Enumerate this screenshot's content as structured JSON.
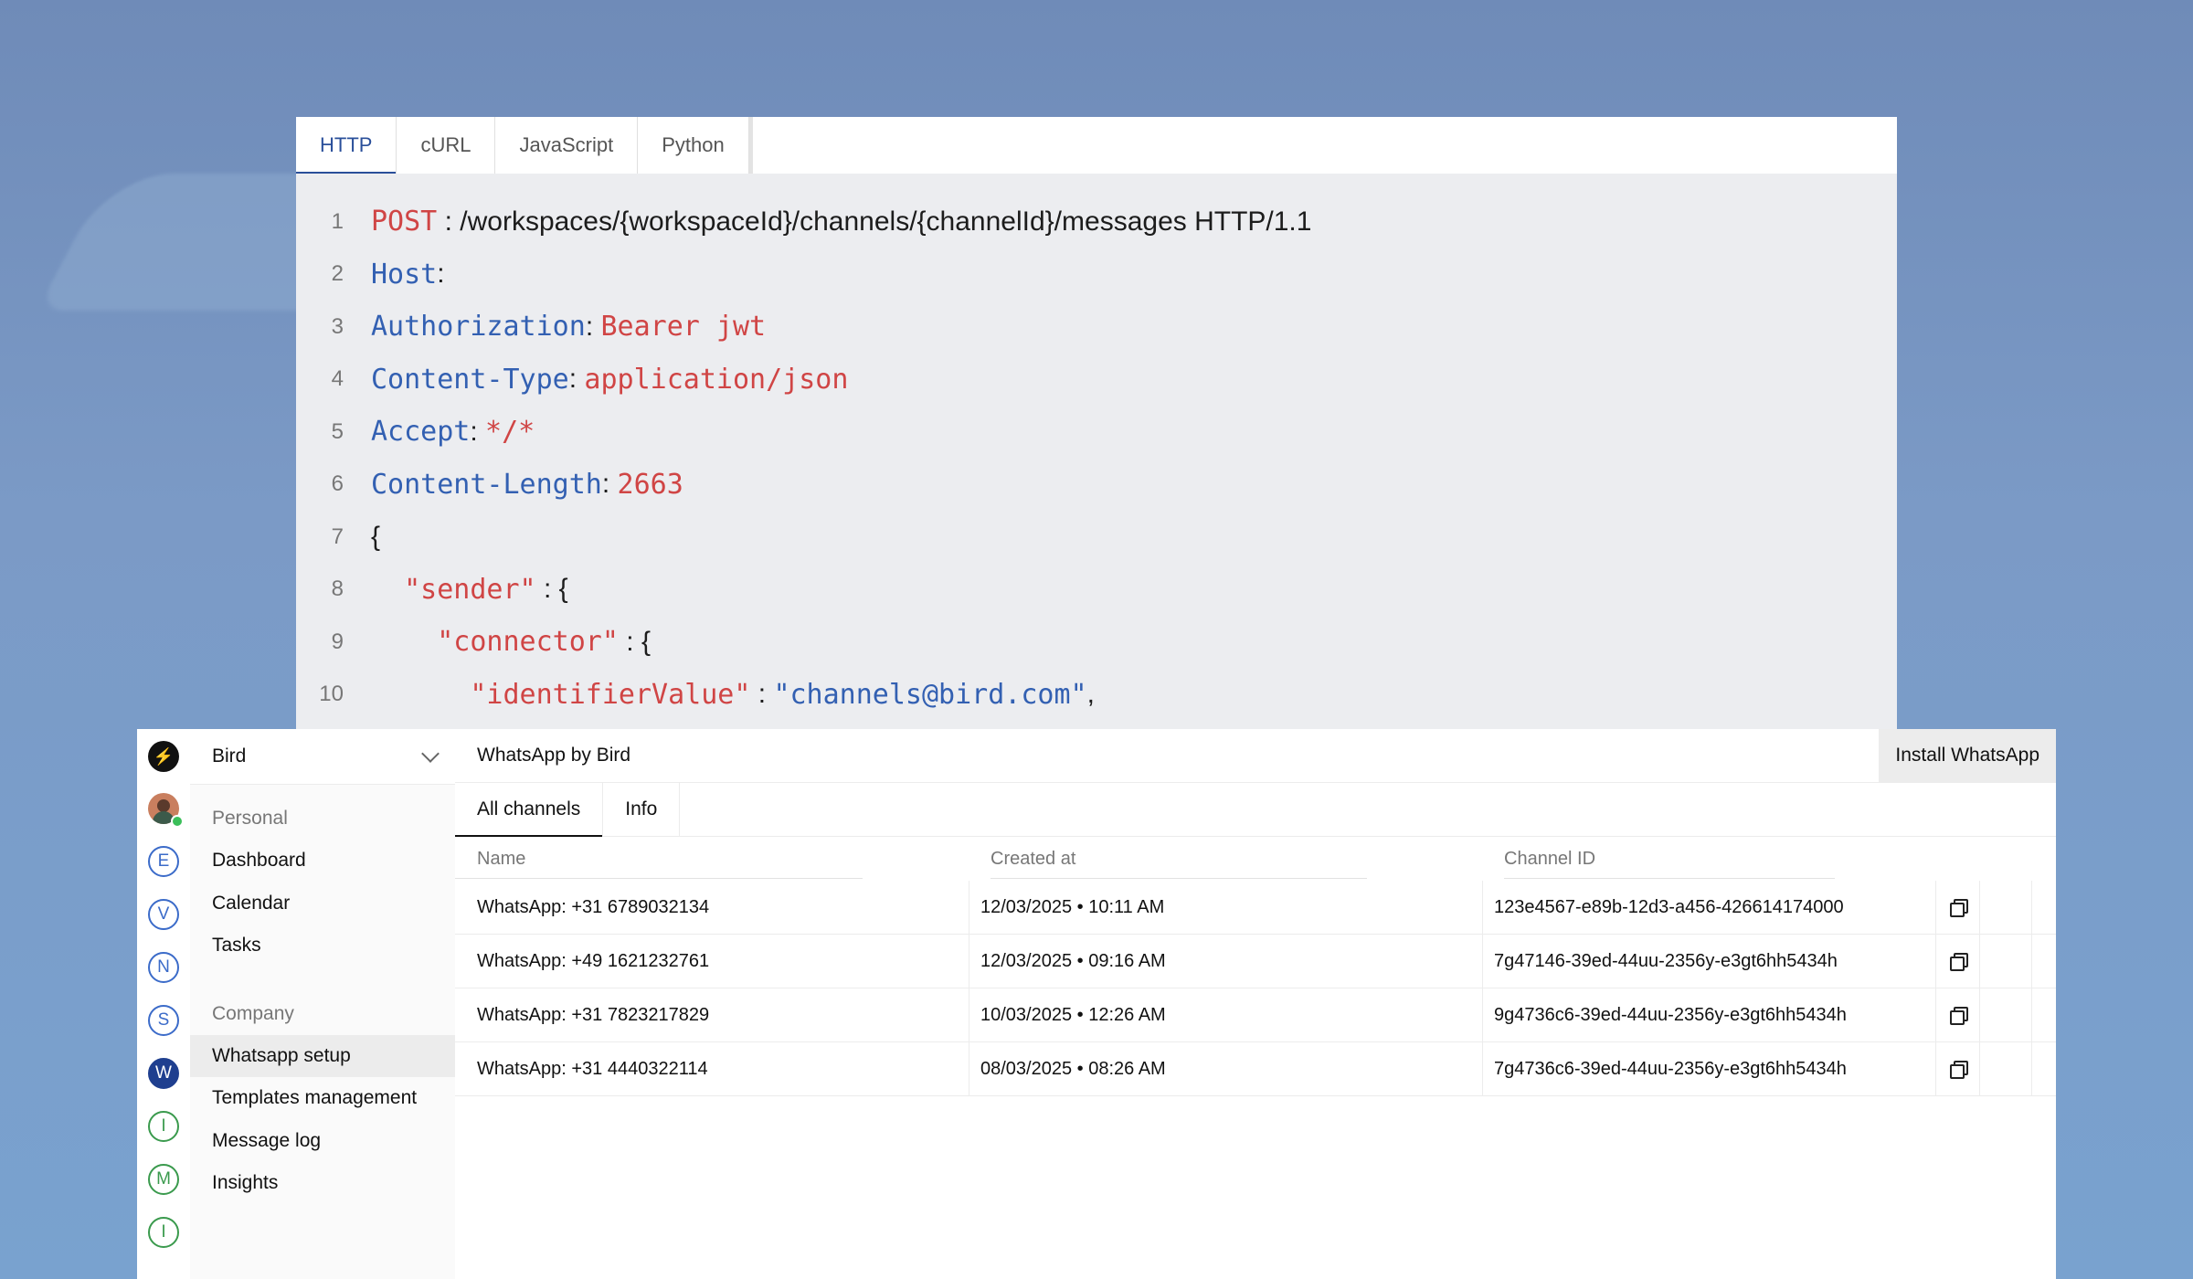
{
  "code_panel": {
    "tabs": [
      "HTTP",
      "cURL",
      "JavaScript",
      "Python"
    ],
    "active_tab": "HTTP",
    "lines": [
      {
        "num": "1",
        "method": "POST",
        "sep": " : ",
        "path": "/workspaces/{workspaceId}/channels/{channelId}/messages HTTP/1.1"
      },
      {
        "num": "2",
        "key": "Host",
        "colon": ":"
      },
      {
        "num": "3",
        "key": "Authorization",
        "colon": ": ",
        "value": "Bearer jwt"
      },
      {
        "num": "4",
        "key": "Content-Type",
        "colon": ": ",
        "value": "application/json"
      },
      {
        "num": "5",
        "key": "Accept",
        "colon": ": ",
        "value": "*/*"
      },
      {
        "num": "6",
        "key": "Content-Length",
        "colon": ": ",
        "value": "2663"
      },
      {
        "num": "7",
        "text": "{"
      },
      {
        "num": "8",
        "indent": "  ",
        "key": "\"sender\"",
        "colon": " : {"
      },
      {
        "num": "9",
        "indent": "    ",
        "key": "\"connector\"",
        "colon": " : {"
      },
      {
        "num": "10",
        "indent": "      ",
        "key": "\"identifierValue\"",
        "colon": " : ",
        "value": "\"channels@bird.com\"",
        "tail": ","
      }
    ]
  },
  "app": {
    "rail": {
      "logo": "⚡",
      "workspaces": [
        "E",
        "V",
        "N",
        "S",
        "W",
        "I",
        "M",
        "I"
      ]
    },
    "sidebar": {
      "org_name": "Bird",
      "personal_label": "Personal",
      "personal_items": [
        "Dashboard",
        "Calendar",
        "Tasks"
      ],
      "company_label": "Company",
      "company_items": [
        "Whatsapp setup",
        "Templates management",
        "Message log",
        "Insights"
      ],
      "active_item": "Whatsapp setup"
    },
    "main": {
      "title": "WhatsApp by Bird",
      "install_label": "Install WhatsApp",
      "tabs": [
        "All channels",
        "Info"
      ],
      "active_tab": "All channels",
      "columns": [
        "Name",
        "Created at",
        "Channel ID"
      ],
      "rows": [
        {
          "name": "WhatsApp: +31 6789032134",
          "created": "12/03/2025 • 10:11 AM",
          "id": "123e4567-e89b-12d3-a456-426614174000"
        },
        {
          "name": "WhatsApp: +49 1621232761",
          "created": "12/03/2025 • 09:16 AM",
          "id": "7g47146-39ed-44uu-2356y-e3gt6hh5434h"
        },
        {
          "name": "WhatsApp: +31 7823217829",
          "created": "10/03/2025 • 12:26 AM",
          "id": "9g4736c6-39ed-44uu-2356y-e3gt6hh5434h"
        },
        {
          "name": "WhatsApp: +31 4440322114",
          "created": "08/03/2025 • 08:26 AM",
          "id": "7g4736c6-39ed-44uu-2356y-e3gt6hh5434h"
        }
      ]
    }
  },
  "colors": {
    "keyword_red": "#d04545",
    "keyword_blue": "#3360b2",
    "active_tab_blue": "#2a4f9a",
    "online_green": "#3bbf5a"
  }
}
